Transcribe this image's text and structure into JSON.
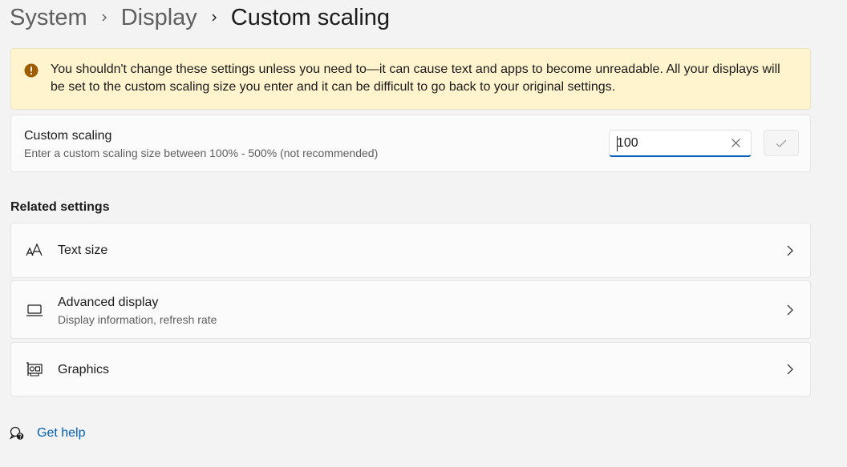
{
  "breadcrumb": {
    "items": [
      "System",
      "Display",
      "Custom scaling"
    ]
  },
  "warning": {
    "icon": "warning-icon",
    "text": "You shouldn't change these settings unless you need to—it can cause text and apps to become unreadable. All your displays will be set to the custom scaling size you enter and it can be difficult to go back to your original settings.",
    "color": "#fff4ce"
  },
  "custom_scaling": {
    "title": "Custom scaling",
    "description": "Enter a custom scaling size between 100% - 500% (not recommended)",
    "input_value": "100"
  },
  "related": {
    "heading": "Related settings",
    "items": [
      {
        "icon": "text-size-icon",
        "label": "Text size"
      },
      {
        "icon": "monitor-icon",
        "label": "Advanced display",
        "sub": "Display information, refresh rate"
      },
      {
        "icon": "graphics-card-icon",
        "label": "Graphics"
      }
    ]
  },
  "help": {
    "label": "Get help",
    "icon": "help-icon"
  },
  "colors": {
    "accent": "#005fb8",
    "background": "#f3f3f3",
    "card": "#fbfbfb"
  }
}
